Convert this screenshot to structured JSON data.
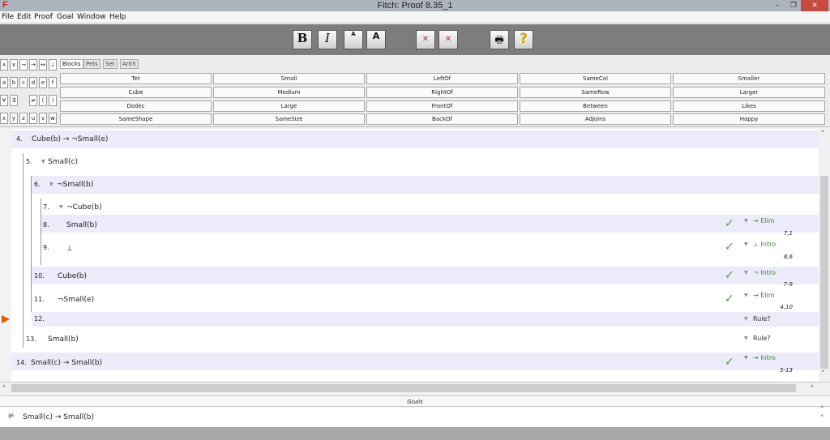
{
  "window": {
    "title": "Fitch: Proof 8.35_1",
    "logo": "F",
    "minimize": "–",
    "maximize": "❐",
    "close": "✕"
  },
  "menu": [
    "File",
    "Edit",
    "Proof",
    "Goal",
    "Window",
    "Help"
  ],
  "toolbar": {
    "bold": "B",
    "italic": "I",
    "small_font": "A",
    "large_font": "A",
    "print": "🖶",
    "help": "?"
  },
  "symbols": {
    "connectives": [
      "∧",
      "∨",
      "¬",
      "→",
      "↔",
      "⊥"
    ],
    "names": [
      "a",
      "b",
      "c",
      "d",
      "e",
      "f"
    ],
    "quantifiers": [
      "∀",
      "∃",
      "≠",
      "(",
      ")"
    ],
    "variables": [
      "x",
      "y",
      "z",
      "u",
      "v",
      "w"
    ]
  },
  "palette_tabs": [
    "Blocks",
    "Pets",
    "Set",
    "Arith"
  ],
  "predicates": [
    [
      "Tet",
      "Small",
      "LeftOf",
      "SameCol",
      "Smaller"
    ],
    [
      "Cube",
      "Medium",
      "RightOf",
      "SameRow",
      "Larger"
    ],
    [
      "Dodec",
      "Large",
      "FrontOf",
      "Between",
      "Likes"
    ],
    [
      "SameShape",
      "SameSize",
      "BackOf",
      "Adjoins",
      "Happy"
    ]
  ],
  "steps": [
    {
      "num": "4.",
      "sentence": "Cube(b) → ¬Small(e)",
      "rule": "",
      "cite": ""
    },
    {
      "num": "5.",
      "sentence": "Small(c)",
      "rule": "",
      "cite": ""
    },
    {
      "num": "6.",
      "sentence": "¬Small(b)",
      "rule": "",
      "cite": ""
    },
    {
      "num": "7.",
      "sentence": "¬Cube(b)",
      "rule": "",
      "cite": ""
    },
    {
      "num": "8.",
      "sentence": "Small(b)",
      "rule": "→ Elim",
      "cite": "7,1"
    },
    {
      "num": "9.",
      "sentence": "⊥",
      "rule": "⊥ Intro",
      "cite": "8,6"
    },
    {
      "num": "10.",
      "sentence": "Cube(b)",
      "rule": "¬ Intro",
      "cite": "7-9"
    },
    {
      "num": "11.",
      "sentence": "¬Small(e)",
      "rule": "→ Elim",
      "cite": "4,10"
    },
    {
      "num": "12.",
      "sentence": "",
      "rule": "Rule?",
      "cite": ""
    },
    {
      "num": "13.",
      "sentence": "Small(b)",
      "rule": "Rule?",
      "cite": ""
    },
    {
      "num": "14.",
      "sentence": "Small(c) → Small(b)",
      "rule": "→ Intro",
      "cite": "5-13"
    }
  ],
  "goals": {
    "header": "Goals",
    "items": [
      "Small(c) → Small(b)"
    ]
  },
  "colors": {
    "check": "#4b9e3b",
    "rule_green": "#3a8a2a",
    "focus_arrow": "#e05a00",
    "band": "#ebebf9",
    "close_button": "#c74a40"
  }
}
